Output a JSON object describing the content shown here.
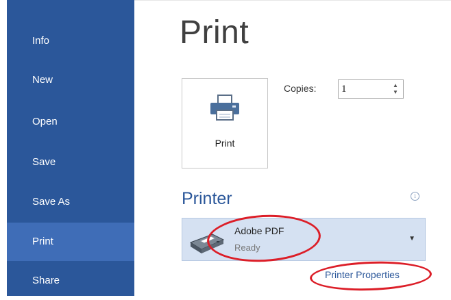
{
  "sidebar": {
    "items": [
      {
        "label": "Info"
      },
      {
        "label": "New"
      },
      {
        "label": "Open"
      },
      {
        "label": "Save"
      },
      {
        "label": "Save As"
      },
      {
        "label": "Print",
        "active": true
      },
      {
        "label": "Share"
      }
    ]
  },
  "main": {
    "title": "Print",
    "print_button_label": "Print",
    "copies": {
      "label": "Copies:",
      "value": "1"
    },
    "printer_section": {
      "title": "Printer",
      "info_icon": "info-icon",
      "selected_printer": {
        "name": "Adobe PDF",
        "status": "Ready"
      },
      "properties_link": "Printer Properties"
    }
  },
  "colors": {
    "sidebar_bg": "#2b579a",
    "sidebar_active": "#3f6db7",
    "accent": "#2b579a",
    "dropdown_bg": "#d5e1f2",
    "annotation_red": "#dc1e28"
  }
}
